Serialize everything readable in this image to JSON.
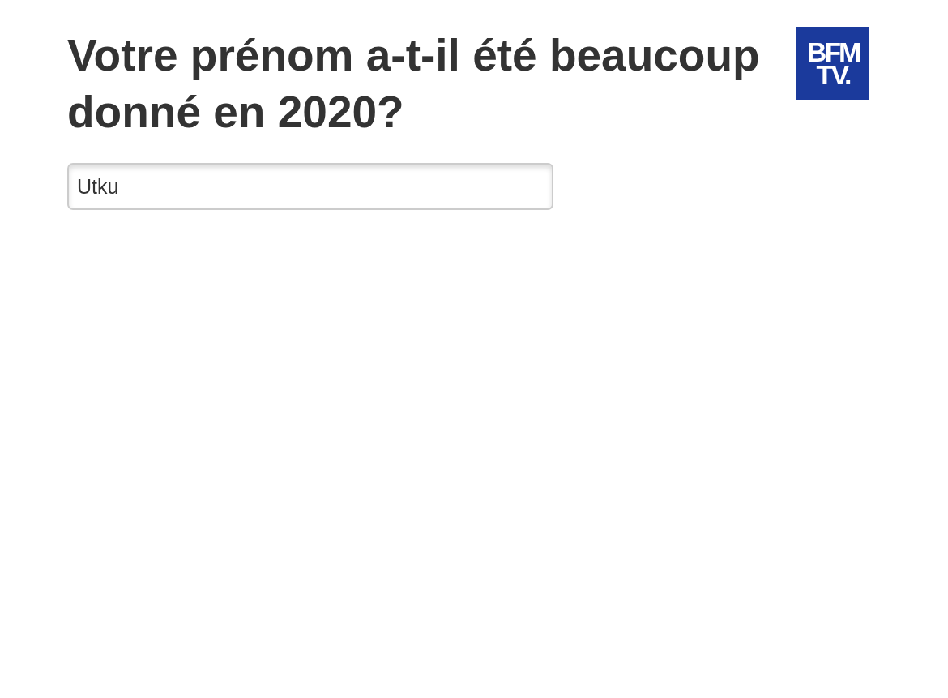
{
  "heading": "Votre prénom a-t-il été beaucoup donné en 2020?",
  "logo": {
    "lines": [
      "BFM",
      "TV."
    ]
  },
  "name_field": {
    "value": "Utku"
  }
}
